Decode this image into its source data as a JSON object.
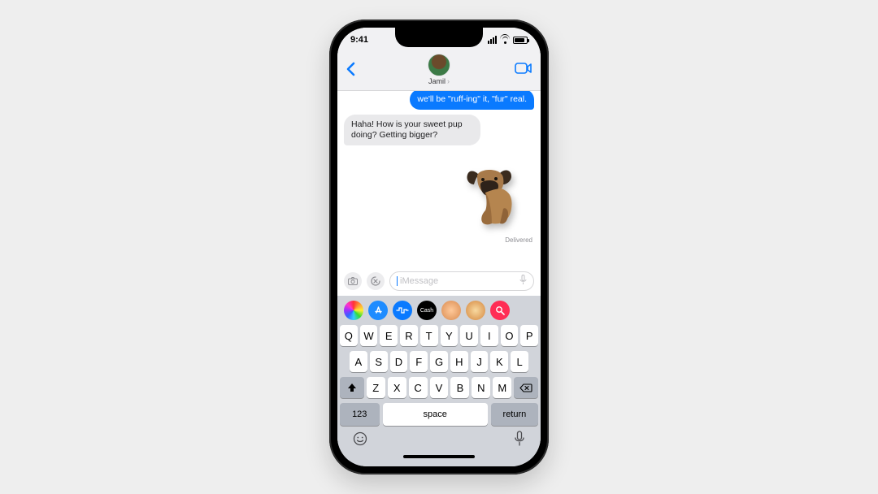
{
  "status": {
    "time": "9:41"
  },
  "nav": {
    "contact_name": "Jamil"
  },
  "messages": {
    "sent_partial": "we'll be \"ruff-ing\" it, \"fur\" real.",
    "received_1": "Haha! How is your sweet pup doing? Getting bigger?",
    "sticker_alt": "dog-sticker",
    "delivered_label": "Delivered"
  },
  "input": {
    "placeholder": "iMessage"
  },
  "apps": {
    "cash_label": "Cash"
  },
  "keyboard": {
    "row1": [
      "Q",
      "W",
      "E",
      "R",
      "T",
      "Y",
      "U",
      "I",
      "O",
      "P"
    ],
    "row2": [
      "A",
      "S",
      "D",
      "F",
      "G",
      "H",
      "J",
      "K",
      "L"
    ],
    "row3": [
      "Z",
      "X",
      "C",
      "V",
      "B",
      "N",
      "M"
    ],
    "num_label": "123",
    "space_label": "space",
    "return_label": "return"
  }
}
